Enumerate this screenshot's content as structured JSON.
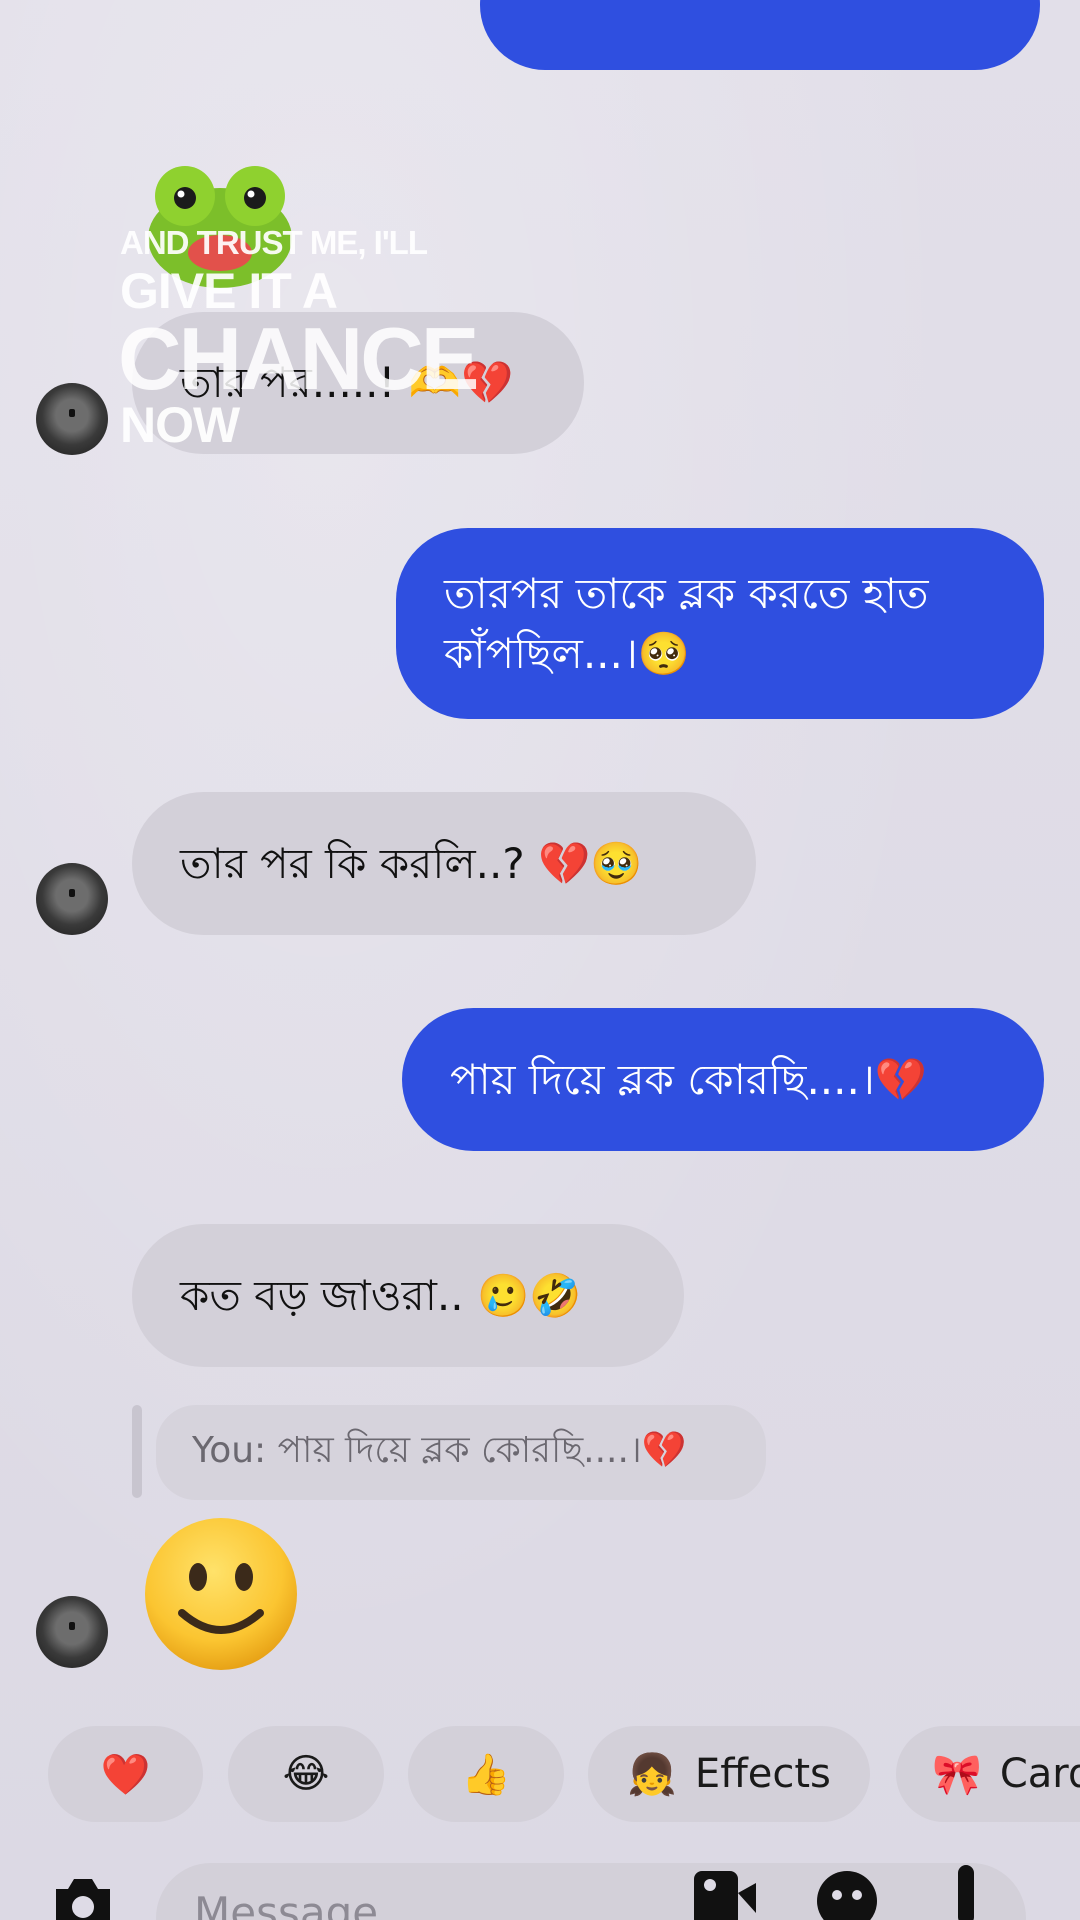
{
  "overlay_sticker": {
    "line1": "AND TRUST ME, I'LL",
    "line2": "GIVE IT A",
    "line3": "CHANCE",
    "line4": "NOW"
  },
  "messages": [
    {
      "id": "m1",
      "side": "in",
      "text": "তার পর.....! 🫶💔"
    },
    {
      "id": "m2",
      "side": "out",
      "line1": "তারপর তাকে ব্লক করতে হাত",
      "line2": "কাঁপছিল...।🥺"
    },
    {
      "id": "m3",
      "side": "in",
      "text": "তার পর কি করলি..? 💔🥹"
    },
    {
      "id": "m4",
      "side": "out",
      "text": "পায় দিয়ে ব্লক কোরছি....।💔"
    },
    {
      "id": "m5",
      "side": "in",
      "text": "কত বড় জাওরা.. 🥲🤣"
    }
  ],
  "reply_preview": {
    "text": "You: পায় দিয়ে ব্লক কোরছি....।💔"
  },
  "reactions": [
    {
      "emoji": "❤️",
      "label": ""
    },
    {
      "emoji": "😂",
      "label": ""
    },
    {
      "emoji": "👍",
      "label": ""
    },
    {
      "emoji": "👧",
      "label": "Effects"
    },
    {
      "emoji": "🎀",
      "label": "Card"
    }
  ],
  "composer": {
    "placeholder": "Message"
  },
  "colors": {
    "background": "#dedbe6",
    "incoming_bubble": "#d3d0d9",
    "outgoing_bubble": "#2f4fe0"
  }
}
